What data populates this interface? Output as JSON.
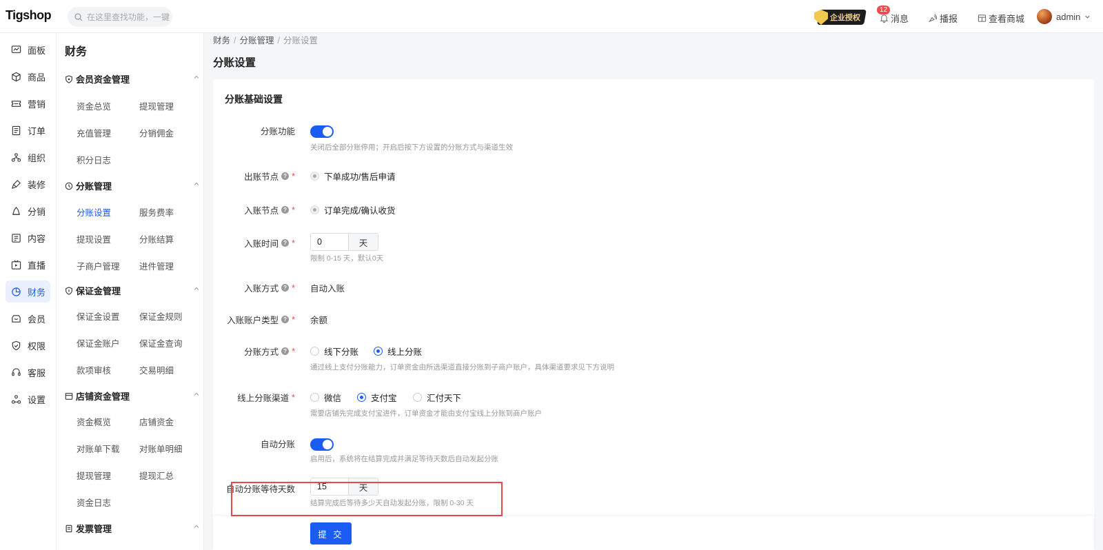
{
  "header": {
    "logo": "Tigshop",
    "search_placeholder": "在这里查找功能，一键直达",
    "auth_badge": "企业授权",
    "messages_label": "消息",
    "messages_count": "12",
    "broadcast_label": "播报",
    "view_store_label": "查看商城",
    "user_name": "admin"
  },
  "leftnav": {
    "items": [
      {
        "label": "面板",
        "icon": "dashboard-icon"
      },
      {
        "label": "商品",
        "icon": "box-icon"
      },
      {
        "label": "营销",
        "icon": "ticket-icon"
      },
      {
        "label": "订单",
        "icon": "order-icon"
      },
      {
        "label": "组织",
        "icon": "org-icon"
      },
      {
        "label": "装修",
        "icon": "brush-icon"
      },
      {
        "label": "分销",
        "icon": "distribution-icon"
      },
      {
        "label": "内容",
        "icon": "content-icon"
      },
      {
        "label": "直播",
        "icon": "live-icon"
      },
      {
        "label": "财务",
        "icon": "finance-icon",
        "active": true
      },
      {
        "label": "会员",
        "icon": "member-icon"
      },
      {
        "label": "权限",
        "icon": "permission-icon"
      },
      {
        "label": "客服",
        "icon": "service-icon"
      },
      {
        "label": "设置",
        "icon": "settings-icon"
      }
    ]
  },
  "subnav": {
    "title": "财务",
    "groups": [
      {
        "title": "会员资金管理",
        "links": [
          "资金总览",
          "提现管理",
          "充值管理",
          "分销佣金",
          "积分日志"
        ]
      },
      {
        "title": "分账管理",
        "links": [
          "分账设置",
          "服务费率",
          "提现设置",
          "分账结算",
          "子商户管理",
          "进件管理"
        ]
      },
      {
        "title": "保证金管理",
        "links": [
          "保证金设置",
          "保证金规则",
          "保证金账户",
          "保证金查询",
          "款项审核",
          "交易明细"
        ]
      },
      {
        "title": "店铺资金管理",
        "links": [
          "资金概览",
          "店铺资金",
          "对账单下载",
          "对账单明细",
          "提现管理",
          "提现汇总",
          "资金日志"
        ]
      },
      {
        "title": "发票管理",
        "links": []
      }
    ]
  },
  "breadcrumb": [
    "财务",
    "分账管理",
    "分账设置"
  ],
  "page_title": "分账设置",
  "form": {
    "section_title": "分账基础设置",
    "split_function": {
      "label": "分账功能",
      "enabled": true,
      "help": "关闭后全部分账停用；开启后按下方设置的分账方式与渠道生效"
    },
    "payout_node": {
      "label": "出账节点",
      "option": "下单成功/售后申请"
    },
    "income_node": {
      "label": "入账节点",
      "option": "订单完成/确认收货"
    },
    "income_time": {
      "label": "入账时间",
      "value": "0",
      "unit": "天",
      "help": "限制 0-15 天，默认0天"
    },
    "income_method": {
      "label": "入账方式",
      "value": "自动入账"
    },
    "account_type": {
      "label": "入账账户类型",
      "value": "余额"
    },
    "split_method": {
      "label": "分账方式",
      "options": [
        "线下分账",
        "线上分账"
      ],
      "selected": "线上分账",
      "help": "通过线上支付分账能力，订单资金由所选渠道直接分账到子商户账户，具体渠道要求见下方说明"
    },
    "online_channel": {
      "label": "线上分账渠道",
      "options": [
        "微信",
        "支付宝",
        "汇付天下"
      ],
      "selected": "支付宝",
      "help": "需要店铺先完成支付宝进件，订单资金才能由支付宝线上分账到商户账户"
    },
    "auto_split": {
      "label": "自动分账",
      "enabled": true,
      "help": "启用后，系统将在结算完成并满足等待天数后自动发起分账"
    },
    "auto_wait_days": {
      "label": "自动分账等待天数",
      "value": "15",
      "unit": "天",
      "help": "结算完成后等待多少天自动发起分账，限制 0-30 天"
    },
    "submit_label": "提 交"
  },
  "colors": {
    "primary": "#1b5cf5",
    "highlight": "#e84a4a",
    "required": "#f04b4b"
  }
}
